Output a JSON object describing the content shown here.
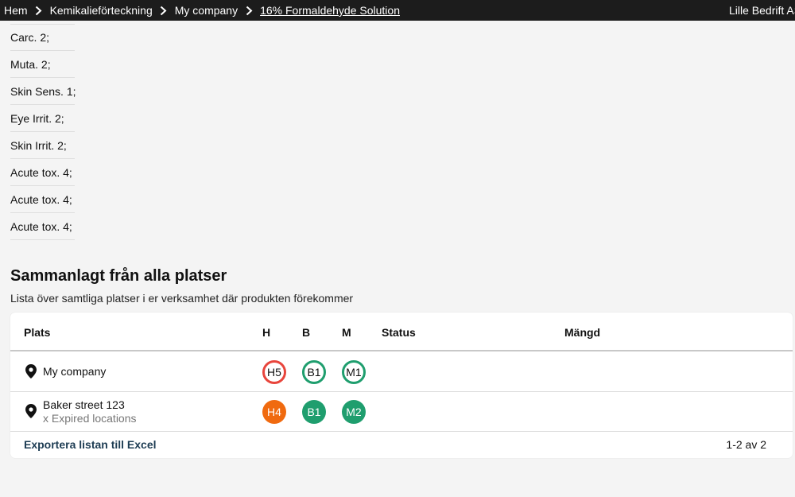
{
  "breadcrumb": {
    "items": [
      "Hem",
      "Kemikalieförteckning",
      "My company",
      "16% Formaldehyde Solution"
    ],
    "company": "Lille Bedrift AS"
  },
  "hazards": [
    "Carc. 2;",
    "Muta. 2;",
    "Skin Sens. 1;",
    "Eye Irrit. 2;",
    "Skin Irrit. 2;",
    "Acute tox. 4;",
    "Acute tox. 4;",
    "Acute tox. 4;"
  ],
  "section": {
    "title": "Sammanlagt från alla platser",
    "subtitle": "Lista över samtliga platser i er verksamhet där produkten förekommer"
  },
  "table": {
    "headers": {
      "plats": "Plats",
      "h": "H",
      "b": "B",
      "m": "M",
      "status": "Status",
      "mangd": "Mängd"
    },
    "rows": [
      {
        "name": "My company",
        "note": "",
        "h": "H5",
        "b": "B1",
        "m": "M1",
        "style": "outline"
      },
      {
        "name": "Baker street 123",
        "note": "x Expired locations",
        "h": "H4",
        "b": "B1",
        "m": "M2",
        "style": "filled"
      }
    ],
    "export_label": "Exportera listan till Excel",
    "pager": "1-2 av 2"
  },
  "colors": {
    "red": "#e8453c",
    "green": "#1f9e6e",
    "orange": "#f06a0f",
    "link": "#1d3c53"
  },
  "icons": {
    "separator": "chevron-right-icon",
    "location": "location-pin-icon"
  }
}
